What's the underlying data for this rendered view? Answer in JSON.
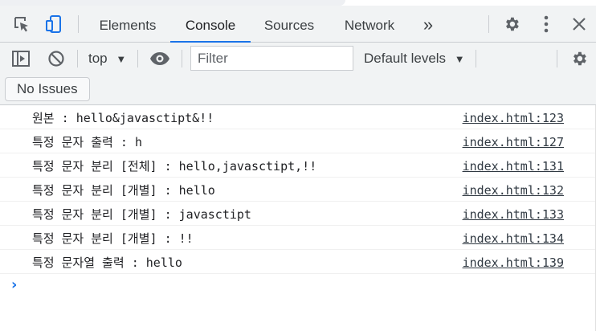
{
  "tabs": [
    {
      "label": "Elements"
    },
    {
      "label": "Console"
    },
    {
      "label": "Sources"
    },
    {
      "label": "Network"
    }
  ],
  "tabs_overflow": "»",
  "toolbar": {
    "context": "top",
    "filter_placeholder": "Filter",
    "levels": "Default levels"
  },
  "issues": {
    "label": "No Issues"
  },
  "messages": [
    {
      "text": "원본 : hello&javasctipt&!!",
      "source": "index.html:123"
    },
    {
      "text": "특정 문자 출력 : h",
      "source": "index.html:127"
    },
    {
      "text": "특정 문자 분리 [전체] : hello,javasctipt,!!",
      "source": "index.html:131"
    },
    {
      "text": "특정 문자 분리 [개별] : hello",
      "source": "index.html:132"
    },
    {
      "text": "특정 문자 분리 [개별] : javasctipt",
      "source": "index.html:133"
    },
    {
      "text": "특정 문자 분리 [개별] : !!",
      "source": "index.html:134"
    },
    {
      "text": "특정 문자열 출력 : hello",
      "source": "index.html:139"
    }
  ],
  "prompt_symbol": "›",
  "colors": {
    "accent": "#1a73e8",
    "toolbar_bg": "#f1f3f4",
    "border": "#cacdd1"
  }
}
